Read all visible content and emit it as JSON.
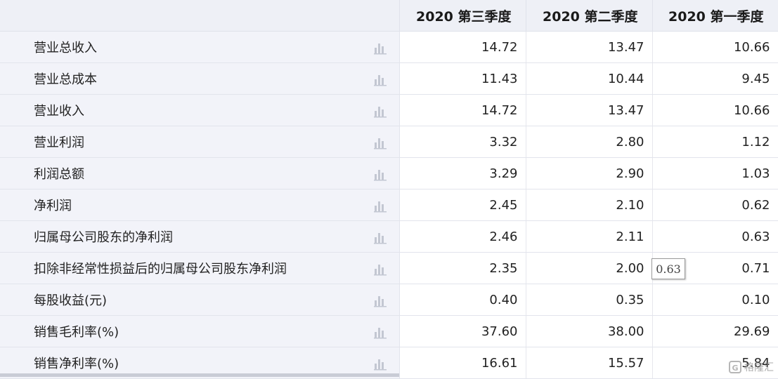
{
  "header": {
    "col1": "2020 第三季度",
    "col2": "2020 第二季度",
    "col3": "2020 第一季度"
  },
  "rows": [
    {
      "label": "营业总收入",
      "q3": "14.72",
      "q2": "13.47",
      "q1": "10.66"
    },
    {
      "label": "营业总成本",
      "q3": "11.43",
      "q2": "10.44",
      "q1": "9.45"
    },
    {
      "label": "营业收入",
      "q3": "14.72",
      "q2": "13.47",
      "q1": "10.66"
    },
    {
      "label": "营业利润",
      "q3": "3.32",
      "q2": "2.80",
      "q1": "1.12"
    },
    {
      "label": "利润总额",
      "q3": "3.29",
      "q2": "2.90",
      "q1": "1.03"
    },
    {
      "label": "净利润",
      "q3": "2.45",
      "q2": "2.10",
      "q1": "0.62"
    },
    {
      "label": "归属母公司股东的净利润",
      "q3": "2.46",
      "q2": "2.11",
      "q1": "0.63"
    },
    {
      "label": "扣除非经常性损益后的归属母公司股东净利润",
      "q3": "2.35",
      "q2": "2.00",
      "q1": "0.71"
    },
    {
      "label": "每股收益(元)",
      "q3": "0.40",
      "q2": "0.35",
      "q1": "0.10"
    },
    {
      "label": "销售毛利率(%)",
      "q3": "37.60",
      "q2": "38.00",
      "q1": "29.69"
    },
    {
      "label": "销售净利率(%)",
      "q3": "16.61",
      "q2": "15.57",
      "q1": "5.84"
    }
  ],
  "tooltip": {
    "text": "0.63"
  },
  "watermark": {
    "text": "格隆汇",
    "logo": "G"
  },
  "icons": {
    "row_chart": "bar-chart-icon"
  },
  "colors": {
    "header_bg": "#eef0f6",
    "label_bg": "#f2f3f9",
    "icon": "#c3c7d2"
  }
}
